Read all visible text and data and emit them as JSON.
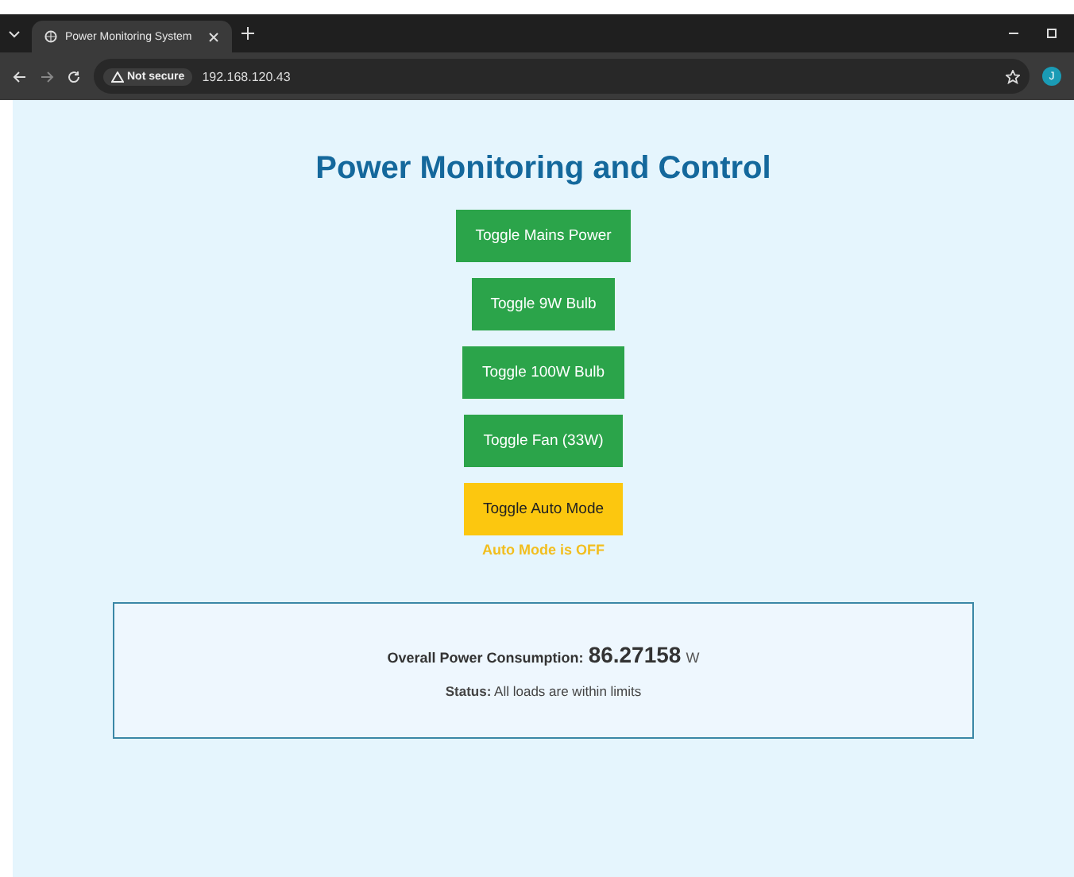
{
  "browser": {
    "tab_title": "Power Monitoring System",
    "security_label": "Not secure",
    "url": "192.168.120.43",
    "profile_initial": "J"
  },
  "page": {
    "title": "Power Monitoring and Control",
    "buttons": [
      {
        "label": "Toggle Mains Power",
        "kind": "load"
      },
      {
        "label": "Toggle 9W Bulb",
        "kind": "load"
      },
      {
        "label": "Toggle 100W Bulb",
        "kind": "load"
      },
      {
        "label": "Toggle Fan (33W)",
        "kind": "load"
      },
      {
        "label": "Toggle Auto Mode",
        "kind": "auto"
      }
    ],
    "auto_mode_status": "Auto Mode is OFF",
    "summary": {
      "consumption_label": "Overall Power Consumption:",
      "consumption_value": "86.27158",
      "consumption_unit": "W",
      "status": "**Status:** All loads are within limits"
    }
  }
}
